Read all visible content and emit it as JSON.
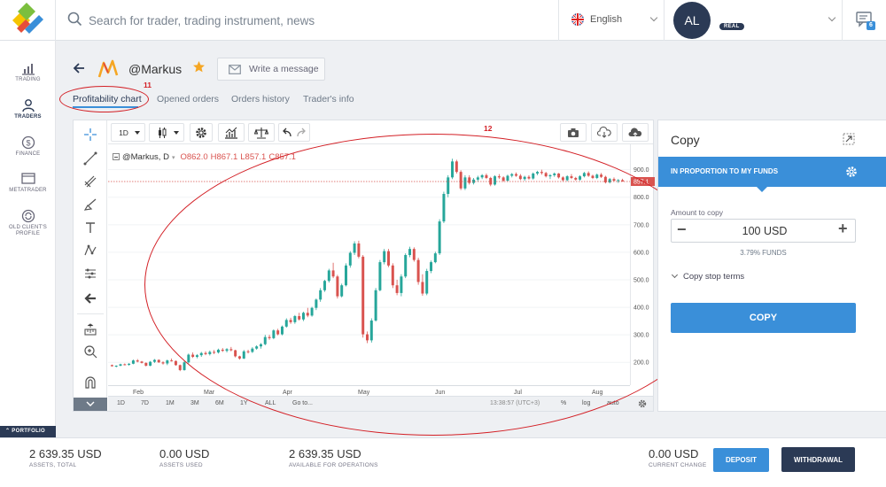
{
  "header": {
    "search_placeholder": "Search for trader, trading instrument, news",
    "language": "English",
    "avatar_initials": "AL",
    "account_badge": "REAL",
    "messages_count": "6"
  },
  "sidebar": {
    "items": [
      {
        "label": "TRADING",
        "icon": "bar-chart-icon"
      },
      {
        "label": "TRADERS",
        "icon": "user-icon"
      },
      {
        "label": "FINANCE",
        "icon": "dollar-icon"
      },
      {
        "label": "METATRADER",
        "icon": "monitor-icon"
      },
      {
        "label": "OLD CLIENT'S PROFILE",
        "icon": "refresh-icon"
      }
    ],
    "active": "TRADERS",
    "portfolio_label": "PORTFOLIO"
  },
  "trader": {
    "name": "@Markus",
    "write_message": "Write a message"
  },
  "tabs": [
    {
      "label": "Profitability chart",
      "active": true
    },
    {
      "label": "Opened orders",
      "active": false
    },
    {
      "label": "Orders history",
      "active": false
    },
    {
      "label": "Trader's info",
      "active": false
    }
  ],
  "annotations": {
    "tabs_marker": "11",
    "chart_marker": "12"
  },
  "chart_toolbar": {
    "interval": "1D"
  },
  "chart_legend": {
    "symbol": "@Markus, D",
    "open": "O862.0",
    "high": "H867.1",
    "low": "L857.1",
    "close": "C857.1"
  },
  "chart_data": {
    "type": "candlestick",
    "symbol": "@Markus",
    "interval": "D",
    "last_price": "857.1",
    "y_ticks": [
      "900.0",
      "800.0",
      "700.0",
      "600.0",
      "500.0",
      "400.0",
      "300.0",
      "200.0"
    ],
    "ylim": [
      130,
      960
    ],
    "x_ticks": [
      "Feb",
      "Mar",
      "Apr",
      "May",
      "Jun",
      "Jul",
      "Aug"
    ],
    "last_ohlc": {
      "open": 862.0,
      "high": 867.1,
      "low": 857.1,
      "close": 857.1
    },
    "candles": [
      [
        190,
        192,
        185,
        186
      ],
      [
        186,
        189,
        182,
        188
      ],
      [
        188,
        195,
        186,
        193
      ],
      [
        193,
        196,
        189,
        191
      ],
      [
        191,
        197,
        188,
        195
      ],
      [
        195,
        210,
        193,
        207
      ],
      [
        207,
        212,
        200,
        203
      ],
      [
        203,
        205,
        196,
        198
      ],
      [
        198,
        200,
        185,
        188
      ],
      [
        188,
        205,
        186,
        202
      ],
      [
        202,
        212,
        198,
        209
      ],
      [
        209,
        211,
        198,
        200
      ],
      [
        200,
        204,
        192,
        196
      ],
      [
        196,
        210,
        190,
        207
      ],
      [
        207,
        214,
        203,
        205
      ],
      [
        205,
        207,
        188,
        190
      ],
      [
        190,
        192,
        168,
        172
      ],
      [
        172,
        205,
        170,
        200
      ],
      [
        200,
        232,
        196,
        228
      ],
      [
        228,
        236,
        216,
        220
      ],
      [
        220,
        230,
        215,
        226
      ],
      [
        226,
        238,
        220,
        234
      ],
      [
        234,
        240,
        226,
        230
      ],
      [
        230,
        243,
        225,
        238
      ],
      [
        238,
        245,
        230,
        236
      ],
      [
        236,
        250,
        232,
        246
      ],
      [
        246,
        252,
        238,
        242
      ],
      [
        242,
        252,
        236,
        248
      ],
      [
        248,
        256,
        240,
        244
      ],
      [
        244,
        246,
        218,
        222
      ],
      [
        222,
        224,
        210,
        214
      ],
      [
        214,
        245,
        212,
        240
      ],
      [
        240,
        246,
        232,
        238
      ],
      [
        238,
        255,
        234,
        250
      ],
      [
        250,
        262,
        246,
        258
      ],
      [
        258,
        270,
        250,
        266
      ],
      [
        266,
        300,
        262,
        292
      ],
      [
        292,
        300,
        282,
        288
      ],
      [
        288,
        320,
        284,
        316
      ],
      [
        316,
        322,
        298,
        302
      ],
      [
        302,
        334,
        298,
        330
      ],
      [
        330,
        360,
        326,
        354
      ],
      [
        354,
        362,
        340,
        346
      ],
      [
        346,
        372,
        340,
        368
      ],
      [
        368,
        380,
        352,
        356
      ],
      [
        356,
        384,
        350,
        380
      ],
      [
        380,
        398,
        364,
        370
      ],
      [
        370,
        402,
        366,
        398
      ],
      [
        398,
        432,
        390,
        428
      ],
      [
        428,
        470,
        420,
        462
      ],
      [
        462,
        500,
        456,
        496
      ],
      [
        496,
        540,
        490,
        534
      ],
      [
        534,
        562,
        506,
        512
      ],
      [
        512,
        518,
        432,
        440
      ],
      [
        440,
        486,
        436,
        480
      ],
      [
        480,
        560,
        476,
        552
      ],
      [
        552,
        604,
        544,
        598
      ],
      [
        598,
        640,
        590,
        632
      ],
      [
        632,
        642,
        578,
        584
      ],
      [
        584,
        590,
        290,
        302
      ],
      [
        302,
        312,
        270,
        280
      ],
      [
        280,
        360,
        272,
        352
      ],
      [
        352,
        470,
        348,
        462
      ],
      [
        462,
        572,
        458,
        564
      ],
      [
        564,
        612,
        556,
        604
      ],
      [
        604,
        612,
        546,
        552
      ],
      [
        552,
        560,
        470,
        480
      ],
      [
        480,
        500,
        444,
        452
      ],
      [
        452,
        520,
        440,
        512
      ],
      [
        512,
        596,
        506,
        590
      ],
      [
        590,
        620,
        582,
        612
      ],
      [
        612,
        618,
        566,
        572
      ],
      [
        572,
        580,
        482,
        492
      ],
      [
        492,
        520,
        442,
        450
      ],
      [
        450,
        540,
        444,
        532
      ],
      [
        532,
        570,
        524,
        564
      ],
      [
        564,
        602,
        560,
        596
      ],
      [
        596,
        720,
        590,
        712
      ],
      [
        712,
        820,
        706,
        812
      ],
      [
        812,
        880,
        800,
        872
      ],
      [
        872,
        940,
        866,
        930
      ],
      [
        930,
        936,
        886,
        892
      ],
      [
        892,
        898,
        826,
        832
      ],
      [
        832,
        880,
        826,
        872
      ],
      [
        872,
        880,
        846,
        852
      ],
      [
        852,
        870,
        846,
        864
      ],
      [
        864,
        878,
        856,
        872
      ],
      [
        872,
        884,
        866,
        880
      ],
      [
        880,
        886,
        866,
        870
      ],
      [
        870,
        874,
        840,
        846
      ],
      [
        846,
        880,
        842,
        876
      ],
      [
        876,
        884,
        866,
        872
      ],
      [
        872,
        876,
        856,
        860
      ],
      [
        860,
        882,
        856,
        878
      ],
      [
        878,
        888,
        872,
        884
      ],
      [
        884,
        890,
        874,
        878
      ],
      [
        878,
        884,
        862,
        866
      ],
      [
        866,
        878,
        860,
        874
      ],
      [
        874,
        880,
        864,
        868
      ],
      [
        868,
        890,
        864,
        886
      ],
      [
        886,
        896,
        880,
        892
      ],
      [
        892,
        900,
        882,
        888
      ],
      [
        888,
        892,
        872,
        876
      ],
      [
        876,
        884,
        866,
        880
      ],
      [
        880,
        890,
        874,
        886
      ],
      [
        886,
        888,
        868,
        872
      ],
      [
        872,
        876,
        858,
        862
      ],
      [
        862,
        880,
        858,
        876
      ],
      [
        876,
        884,
        866,
        870
      ],
      [
        870,
        874,
        860,
        864
      ],
      [
        864,
        880,
        860,
        876
      ],
      [
        876,
        892,
        872,
        888
      ],
      [
        888,
        894,
        874,
        878
      ],
      [
        878,
        882,
        866,
        870
      ],
      [
        870,
        886,
        866,
        882
      ],
      [
        882,
        888,
        870,
        874
      ],
      [
        874,
        878,
        850,
        854
      ],
      [
        854,
        870,
        850,
        866
      ],
      [
        866,
        872,
        856,
        860
      ],
      [
        860,
        866,
        852,
        862
      ],
      [
        862,
        867.1,
        857.1,
        857.1
      ]
    ]
  },
  "time_ranges": [
    "1D",
    "7D",
    "1M",
    "3M",
    "6M",
    "1Y",
    "ALL",
    "Go to..."
  ],
  "chart_status": {
    "time": "13:38:57 (UTC+3)",
    "percent": "%",
    "log": "log",
    "auto": "auto"
  },
  "copy_panel": {
    "title": "Copy",
    "mode": "IN PROPORTION TO MY FUNDS",
    "amount_label": "Amount to copy",
    "amount": "100 USD",
    "funds_pct": "3.79% FUNDS",
    "stop_terms": "Copy stop terms",
    "copy_button": "COPY"
  },
  "footer": {
    "stats": [
      {
        "value": "2 639.35 USD",
        "label": "ASSETS, TOTAL"
      },
      {
        "value": "0.00 USD",
        "label": "ASSETS USED"
      },
      {
        "value": "2 639.35 USD",
        "label": "AVAILABLE FOR OPERATIONS"
      },
      {
        "value": "0.00 USD",
        "label": "CURRENT CHANGE"
      }
    ],
    "deposit": "DEPOSIT",
    "withdrawal": "WITHDRAWAL"
  },
  "colors": {
    "accent": "#3a8fd9",
    "navy": "#2b3a55",
    "up": "#26a69a",
    "down": "#d9534f",
    "annotation": "#d31f25"
  }
}
